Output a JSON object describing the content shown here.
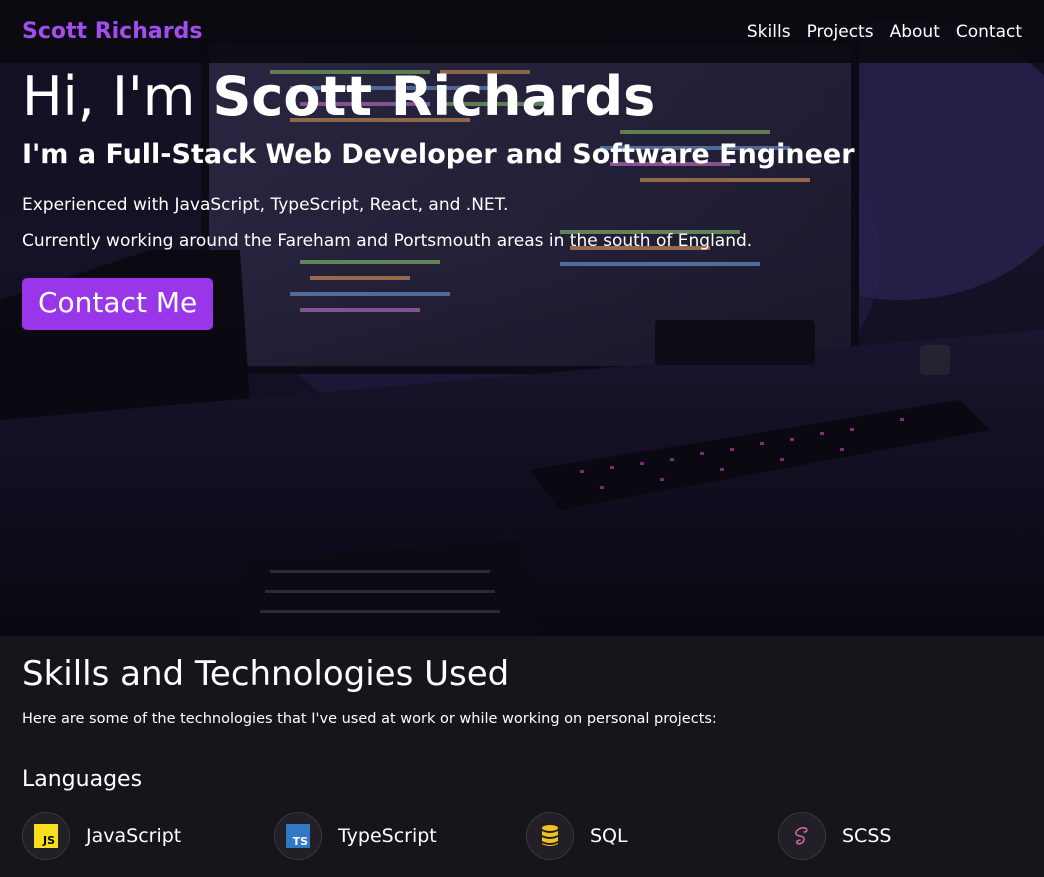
{
  "navbar": {
    "brand": "Scott Richards",
    "links": [
      "Skills",
      "Projects",
      "About",
      "Contact"
    ]
  },
  "hero": {
    "title_prefix": "Hi, I'm ",
    "title_name": "Scott Richards",
    "sub_prefix": "I'm a ",
    "sub_role1": "Full-Stack Web Developer",
    "sub_middle": " and ",
    "sub_role2": "Software Engineer",
    "line1": "Experienced with JavaScript, TypeScript, React, and .NET.",
    "line2": "Currently working around the Fareham and Portsmouth areas in the south of England.",
    "cta": "Contact Me"
  },
  "skills": {
    "title": "Skills and Technologies Used",
    "intro": "Here are some of the technologies that I've used at work or while working on personal projects:",
    "languages_title": "Languages",
    "languages": [
      {
        "name": "JavaScript",
        "icon": "javascript-icon"
      },
      {
        "name": "TypeScript",
        "icon": "typescript-icon"
      },
      {
        "name": "SQL",
        "icon": "database-icon"
      },
      {
        "name": "SCSS",
        "icon": "sass-icon"
      }
    ]
  },
  "colors": {
    "accent": "#9a36ea",
    "brand": "#a24df0",
    "background": "#17151b",
    "javascript": "#f7df1e",
    "typescript": "#3178c6",
    "sql": "#f0c419",
    "scss": "#cd6799"
  }
}
